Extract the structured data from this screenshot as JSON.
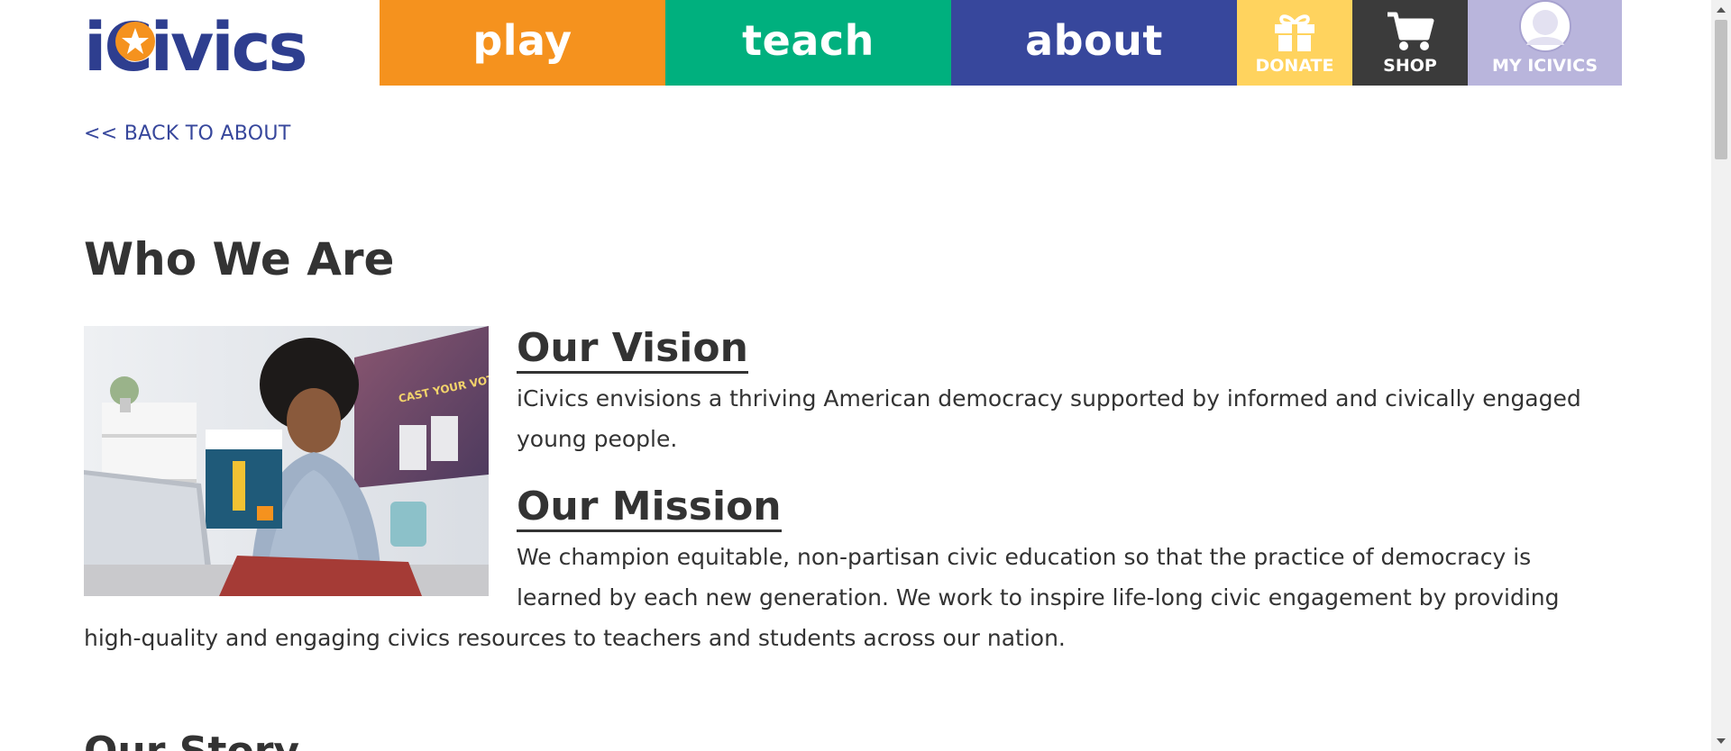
{
  "brand": {
    "logo_text": "iCivics",
    "colors": {
      "navy": "#2e3e8f",
      "orange": "#f5921e",
      "green": "#00b07e",
      "blue": "#37479c",
      "yellow": "#ffd35e",
      "dark": "#3b3b3b",
      "lavender": "#b9b5dc"
    }
  },
  "nav": {
    "play": "play",
    "teach": "teach",
    "about": "about",
    "donate": "DONATE",
    "shop": "SHOP",
    "my_icivics": "MY ICIVICS"
  },
  "icons": {
    "donate": "gift-icon",
    "shop": "cart-icon",
    "my_icivics": "user-avatar-icon"
  },
  "back_link": "<< BACK TO ABOUT",
  "page_title": "Who We Are",
  "hero_image": {
    "alt": "Woman at a laptop holding up an infographic",
    "poster_text": "CAST YOUR VOTE"
  },
  "sections": {
    "vision": {
      "heading": "Our Vision",
      "body": "iCivics envisions a thriving American democracy supported by informed and civically engaged young people."
    },
    "mission": {
      "heading": "Our Mission",
      "body": "We champion equitable, non-partisan civic education so that the practice of democracy is learned by each new generation. We work to inspire life-long civic engagement by providing high-quality and engaging civics resources to teachers and students across our nation."
    },
    "story": {
      "heading": "Our Story"
    }
  }
}
